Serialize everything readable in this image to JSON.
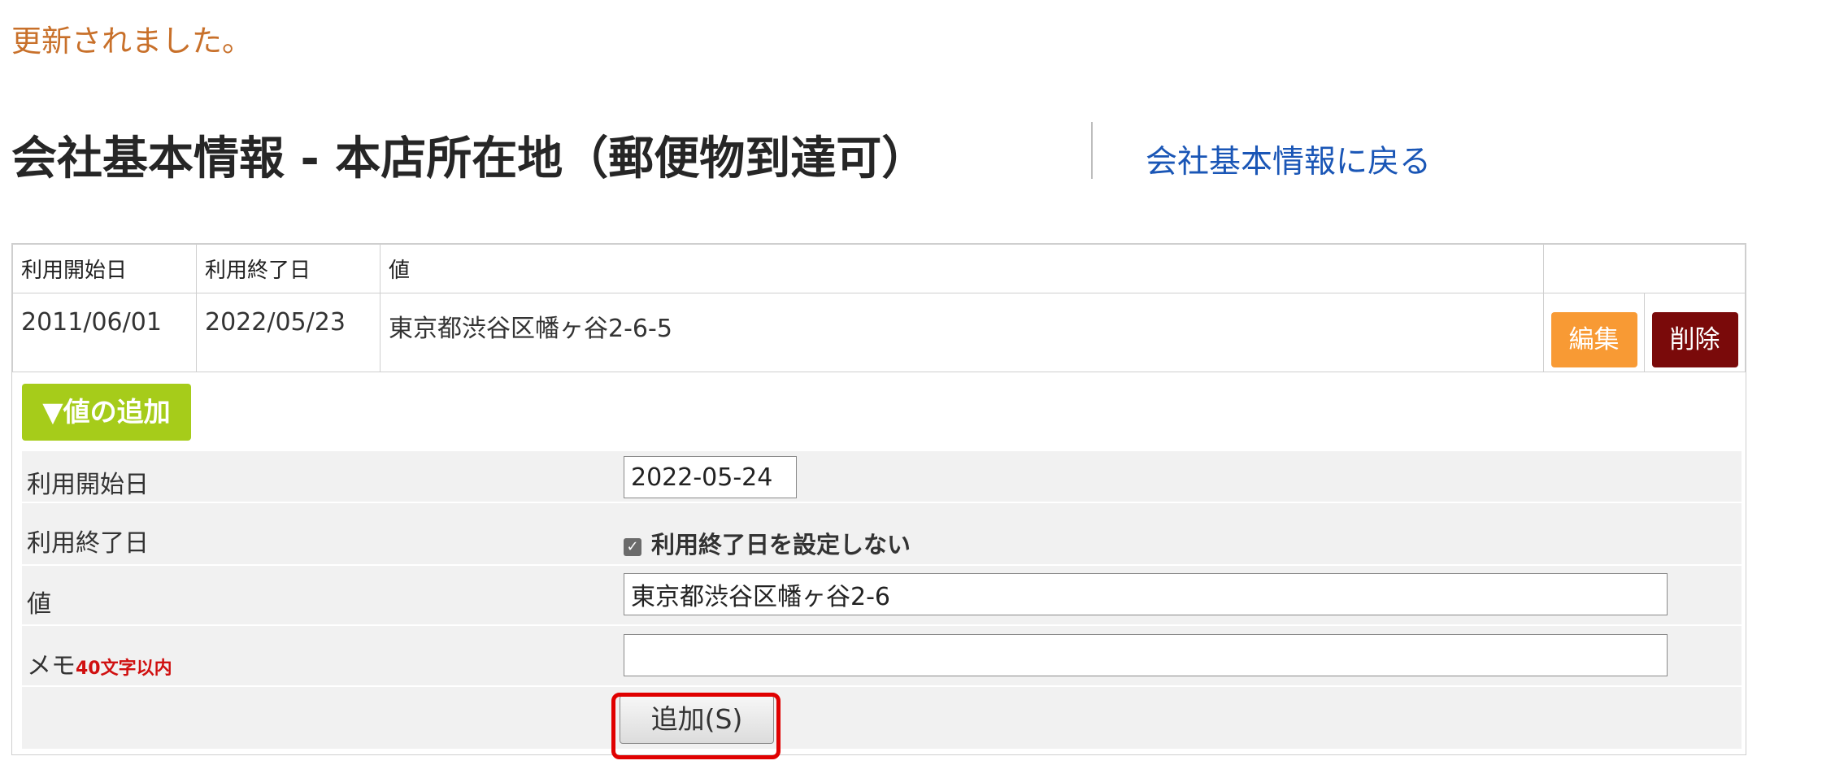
{
  "flash_message": "更新されました。",
  "page_title": "会社基本情報 - 本店所在地（郵便物到達可）",
  "back_link": "会社基本情報に戻る",
  "table": {
    "headers": [
      "利用開始日",
      "利用終了日",
      "値",
      ""
    ],
    "rows": [
      {
        "start": "2011/06/01",
        "end": "2022/05/23",
        "value": "東京都渋谷区幡ヶ谷2-6-5",
        "edit_label": "編集",
        "delete_label": "削除"
      }
    ]
  },
  "add_toggle_label": "▼値の追加",
  "form": {
    "start_label": "利用開始日",
    "start_value": "2022-05-24",
    "end_label": "利用終了日",
    "no_end_checkbox_label": "利用終了日を設定しない",
    "no_end_checked": true,
    "value_label": "値",
    "value_value": "東京都渋谷区幡ヶ谷2-6",
    "memo_label": "メモ",
    "memo_note": "40文字以内",
    "memo_value": "",
    "submit_label": "追加(S)"
  },
  "colors": {
    "flash": "#c8702a",
    "link": "#1a56b6",
    "edit_button": "#f89a34",
    "delete_button": "#7a0a0a",
    "add_toggle": "#a6cc1a",
    "highlight": "#e00000",
    "memo_note": "#d01010"
  }
}
